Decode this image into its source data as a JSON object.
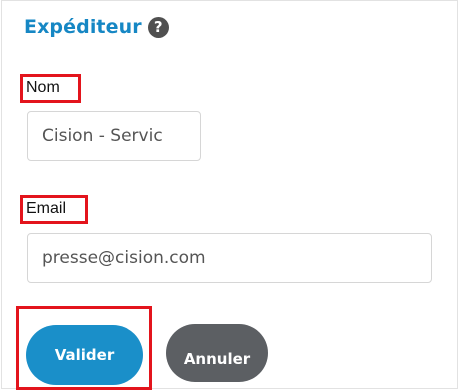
{
  "section": {
    "title": "Expéditeur",
    "help_icon": "question-circle-icon",
    "help_glyph": "?"
  },
  "fields": {
    "name": {
      "label": "Nom",
      "value": "Cision - Servic"
    },
    "email": {
      "label": "Email",
      "value": "presse@cision.com"
    }
  },
  "actions": {
    "validate_label": "Valider",
    "cancel_label": "Annuler"
  },
  "colors": {
    "title": "#1687c4",
    "highlight": "#e3141c",
    "validate_button": "#1a8fc9",
    "cancel_button": "#5c5f63"
  }
}
